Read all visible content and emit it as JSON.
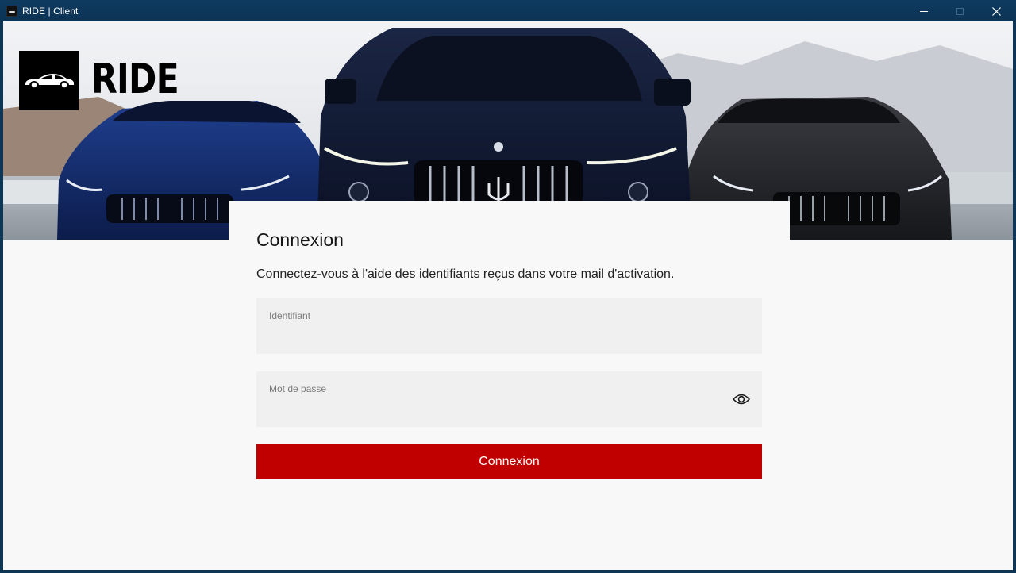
{
  "window": {
    "title": "RIDE | Client"
  },
  "brand": {
    "name": "RIDE",
    "logo_icon": "car-icon"
  },
  "hero": {
    "image": "three-dark-maserati-cars-banner"
  },
  "login": {
    "title": "Connexion",
    "description": "Connectez-vous à l'aide des identifiants reçus dans votre mail d'activation.",
    "username": {
      "label": "Identifiant",
      "value": ""
    },
    "password": {
      "label": "Mot de passe",
      "value": "",
      "toggle_icon": "eye-icon"
    },
    "submit_label": "Connexion"
  },
  "colors": {
    "accent": "#c00000",
    "titlebar": "#0d3556",
    "background": "#f8f8f8",
    "field": "#f0f0f0"
  }
}
